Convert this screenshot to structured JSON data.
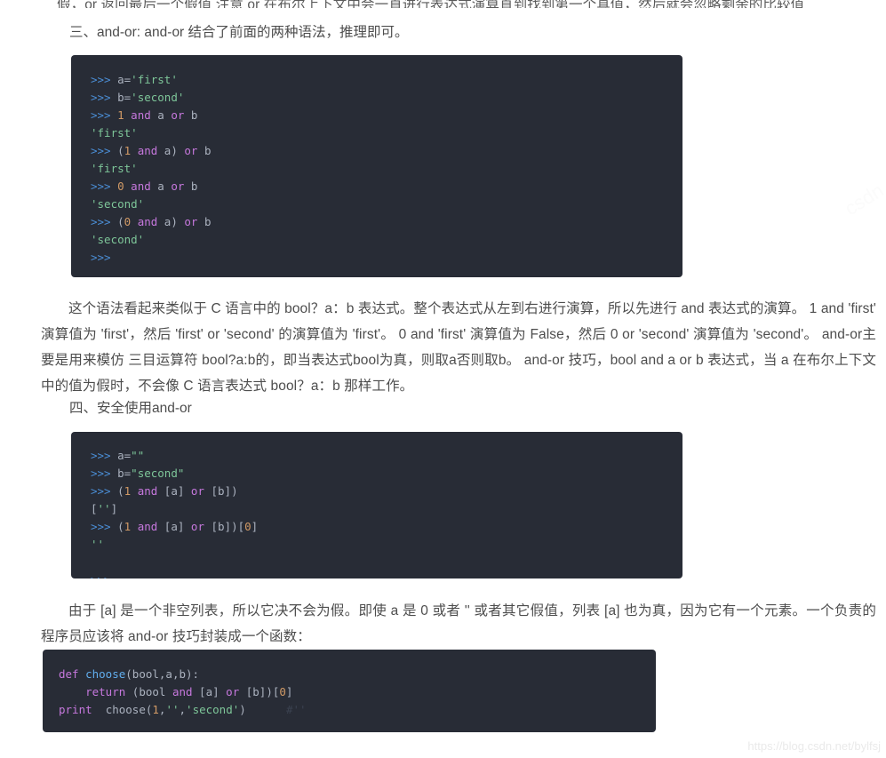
{
  "document": {
    "top_clipped_line": "假，or 返回最后一个假值 注意 or 在布尔上下文中会一直进行表达式演算直到找到第一个真值，然后就会忽略剩余的比较值",
    "section_three_heading": "三、and-or: and-or 结合了前面的两种语法，推理即可。",
    "section_four_heading": "四、安全使用and-or",
    "paragraph_after_block_one": "这个语法看起来类似于 C 语言中的 bool？a：b 表达式。整个表达式从左到右进行演算，所以先进行 and 表达式的演算。 1 and 'first' 演算值为 'first'，然后 'first' or 'second' 的演算值为 'first'。 0 and 'first' 演算值为 False，然后 0 or 'second' 演算值为 'second'。 and-or主要是用来模仿 三目运算符 bool?a:b的，即当表达式bool为真，则取a否则取b。 and-or 技巧，bool and a or b 表达式，当 a 在布尔上下文中的值为假时，不会像 C 语言表达式 bool？a：b 那样工作。",
    "paragraph_after_block_two": "由于 [a] 是一个非空列表，所以它决不会为假。即使 a 是 0 或者 '' 或者其它假值，列表 [a] 也为真，因为它有一个元素。一个负责的程序员应该将 and-or 技巧封装成一个函数："
  },
  "code_block_one": {
    "name": "and-or-repl-example",
    "lines": [
      [
        {
          "text": ">>> ",
          "token": "prompt"
        },
        {
          "text": "a=",
          "token": "plain"
        },
        {
          "text": "'first'",
          "token": "str"
        }
      ],
      [
        {
          "text": ">>> ",
          "token": "prompt"
        },
        {
          "text": "b=",
          "token": "plain"
        },
        {
          "text": "'second'",
          "token": "str"
        }
      ],
      [
        {
          "text": ">>> ",
          "token": "prompt"
        },
        {
          "text": "1",
          "token": "num"
        },
        {
          "text": " ",
          "token": "plain"
        },
        {
          "text": "and",
          "token": "kw"
        },
        {
          "text": " a ",
          "token": "plain"
        },
        {
          "text": "or",
          "token": "kw"
        },
        {
          "text": " b",
          "token": "plain"
        }
      ],
      [
        {
          "text": "'first'",
          "token": "str"
        }
      ],
      [
        {
          "text": ">>> ",
          "token": "prompt"
        },
        {
          "text": "(",
          "token": "punct"
        },
        {
          "text": "1",
          "token": "num"
        },
        {
          "text": " ",
          "token": "plain"
        },
        {
          "text": "and",
          "token": "kw"
        },
        {
          "text": " a) ",
          "token": "plain"
        },
        {
          "text": "or",
          "token": "kw"
        },
        {
          "text": " b",
          "token": "plain"
        }
      ],
      [
        {
          "text": "'first'",
          "token": "str"
        }
      ],
      [
        {
          "text": ">>> ",
          "token": "prompt"
        },
        {
          "text": "0",
          "token": "num"
        },
        {
          "text": " ",
          "token": "plain"
        },
        {
          "text": "and",
          "token": "kw"
        },
        {
          "text": " a ",
          "token": "plain"
        },
        {
          "text": "or",
          "token": "kw"
        },
        {
          "text": " b",
          "token": "plain"
        }
      ],
      [
        {
          "text": "'second'",
          "token": "str"
        }
      ],
      [
        {
          "text": ">>> ",
          "token": "prompt"
        },
        {
          "text": "(",
          "token": "punct"
        },
        {
          "text": "0",
          "token": "num"
        },
        {
          "text": " ",
          "token": "plain"
        },
        {
          "text": "and",
          "token": "kw"
        },
        {
          "text": " a) ",
          "token": "plain"
        },
        {
          "text": "or",
          "token": "kw"
        },
        {
          "text": " b",
          "token": "plain"
        }
      ],
      [
        {
          "text": "'second'",
          "token": "str"
        }
      ],
      [
        {
          "text": ">>>",
          "token": "prompt"
        }
      ]
    ]
  },
  "code_block_two": {
    "name": "safe-and-or-repl-example",
    "lines": [
      [
        {
          "text": ">>> ",
          "token": "prompt"
        },
        {
          "text": "a=",
          "token": "plain"
        },
        {
          "text": "\"\"",
          "token": "str"
        }
      ],
      [
        {
          "text": ">>> ",
          "token": "prompt"
        },
        {
          "text": "b=",
          "token": "plain"
        },
        {
          "text": "\"second\"",
          "token": "str"
        }
      ],
      [
        {
          "text": ">>> ",
          "token": "prompt"
        },
        {
          "text": "(",
          "token": "punct"
        },
        {
          "text": "1",
          "token": "num"
        },
        {
          "text": " ",
          "token": "plain"
        },
        {
          "text": "and",
          "token": "kw"
        },
        {
          "text": " [a] ",
          "token": "plain"
        },
        {
          "text": "or",
          "token": "kw"
        },
        {
          "text": " [b])",
          "token": "plain"
        }
      ],
      [
        {
          "text": "[",
          "token": "punct"
        },
        {
          "text": "''",
          "token": "str"
        },
        {
          "text": "]",
          "token": "punct"
        }
      ],
      [
        {
          "text": ">>> ",
          "token": "prompt"
        },
        {
          "text": "(",
          "token": "punct"
        },
        {
          "text": "1",
          "token": "num"
        },
        {
          "text": " ",
          "token": "plain"
        },
        {
          "text": "and",
          "token": "kw"
        },
        {
          "text": " [a] ",
          "token": "plain"
        },
        {
          "text": "or",
          "token": "kw"
        },
        {
          "text": " [b])[",
          "token": "plain"
        },
        {
          "text": "0",
          "token": "num"
        },
        {
          "text": "]",
          "token": "plain"
        }
      ],
      [
        {
          "text": "''",
          "token": "str"
        }
      ],
      [
        {
          "text": "",
          "token": "plain"
        }
      ],
      [
        {
          "text": ">>>",
          "token": "prompt"
        }
      ]
    ]
  },
  "code_block_three": {
    "name": "choose-function-definition",
    "lines": [
      [
        {
          "text": "def",
          "token": "kw"
        },
        {
          "text": " ",
          "token": "plain"
        },
        {
          "text": "choose",
          "token": "fn"
        },
        {
          "text": "(bool,a,b):",
          "token": "plain"
        }
      ],
      [
        {
          "text": "    ",
          "token": "plain"
        },
        {
          "text": "return",
          "token": "kw"
        },
        {
          "text": " (bool ",
          "token": "plain"
        },
        {
          "text": "and",
          "token": "kw"
        },
        {
          "text": " [a] ",
          "token": "plain"
        },
        {
          "text": "or",
          "token": "kw"
        },
        {
          "text": " [b])[",
          "token": "plain"
        },
        {
          "text": "0",
          "token": "num"
        },
        {
          "text": "]",
          "token": "plain"
        }
      ],
      [
        {
          "text": "print",
          "token": "kw"
        },
        {
          "text": "  ",
          "token": "plain"
        },
        {
          "text": "choose",
          "token": "plain"
        },
        {
          "text": "(",
          "token": "plain"
        },
        {
          "text": "1",
          "token": "num"
        },
        {
          "text": ",",
          "token": "plain"
        },
        {
          "text": "''",
          "token": "str"
        },
        {
          "text": ",",
          "token": "plain"
        },
        {
          "text": "'second'",
          "token": "str"
        },
        {
          "text": ")",
          "token": "plain"
        },
        {
          "text": "      ",
          "token": "plain"
        },
        {
          "text": "#''",
          "token": "comment"
        }
      ]
    ]
  },
  "watermark": {
    "url": "https://blog.csdn.net/bylfsj",
    "diagonal": "csdn"
  },
  "colors": {
    "page_background": "#ffffff",
    "body_text": "#4d4d4d",
    "code_background": "#282c36",
    "code_default": "#abb2bf",
    "token_prompt": "#4b8ed6",
    "token_string": "#7ec699",
    "token_keyword": "#c678dd",
    "token_number": "#d19a66",
    "token_function": "#61aeee",
    "token_comment": "#3b4250",
    "watermark": "#eaeaea"
  }
}
